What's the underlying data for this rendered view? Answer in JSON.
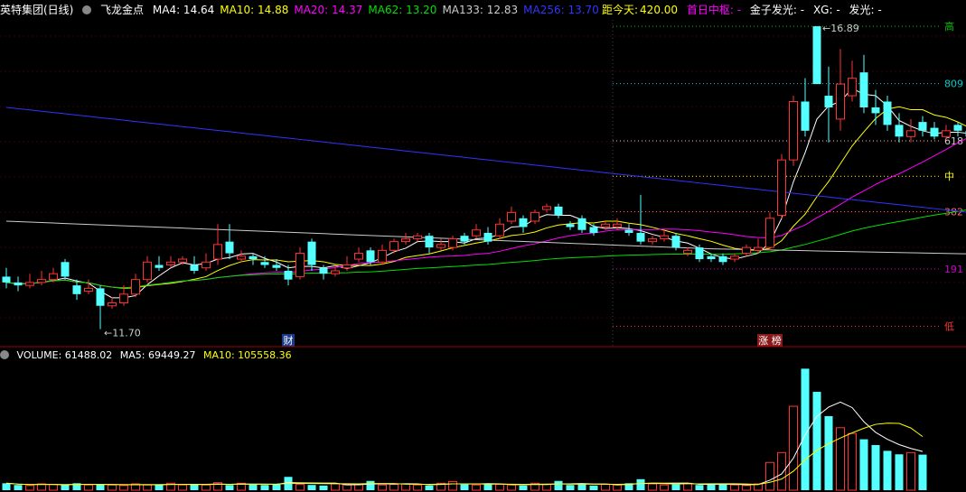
{
  "header": {
    "stock_name": "英特集团(日线)",
    "indicator_name": "飞龙金点",
    "ma": [
      {
        "label": "MA4:",
        "value": "14.64",
        "color": "#ffffff"
      },
      {
        "label": "MA10:",
        "value": "14.88",
        "color": "#ffff00"
      },
      {
        "label": "MA20:",
        "value": "14.37",
        "color": "#ff00ff"
      },
      {
        "label": "MA62:",
        "value": "13.20",
        "color": "#00e000"
      },
      {
        "label": "MA133:",
        "value": "12.83",
        "color": "#cccccc"
      },
      {
        "label": "MA256:",
        "value": "13.70",
        "color": "#3333ff"
      }
    ],
    "right": {
      "days_label": "距今天:",
      "days_value": "420.00",
      "first_day": "首日中枢: -",
      "signal1": "金子发光: -",
      "xg": "XG: -",
      "signal2": "发光: -"
    }
  },
  "price_axis": {
    "high_label": "16.89",
    "low_label": "11.70",
    "fib": [
      {
        "label": "高",
        "color": "#00c000"
      },
      {
        "label": "809",
        "color": "#00cccc"
      },
      {
        "label": "618",
        "color": "#cccccc"
      },
      {
        "label": "中",
        "color": "#ffff00"
      },
      {
        "label": "382",
        "color": "#ff6666"
      },
      {
        "label": "191",
        "color": "#cc00cc"
      },
      {
        "label": "低",
        "color": "#ff3333"
      }
    ],
    "markers": [
      {
        "label": "财"
      },
      {
        "label": "涨 榜"
      }
    ]
  },
  "volume_header": {
    "volume": "VOLUME: 61488.02",
    "ma5": "MA5: 69449.27",
    "ma10": "MA10: 105558.36"
  },
  "chart_data": {
    "type": "candlestick",
    "price_range": [
      11.4,
      17.0
    ],
    "candles": [
      [
        12.6,
        12.5,
        12.75,
        12.4
      ],
      [
        12.5,
        12.45,
        12.6,
        12.35
      ],
      [
        12.45,
        12.5,
        12.65,
        12.4
      ],
      [
        12.5,
        12.55,
        12.7,
        12.45
      ],
      [
        12.55,
        12.65,
        12.75,
        12.5
      ],
      [
        12.85,
        12.6,
        12.9,
        12.55
      ],
      [
        12.45,
        12.3,
        12.55,
        12.2
      ],
      [
        12.35,
        12.4,
        12.55,
        12.3
      ],
      [
        12.4,
        12.1,
        12.45,
        11.7
      ],
      [
        12.1,
        12.15,
        12.25,
        12.05
      ],
      [
        12.15,
        12.3,
        12.45,
        12.1
      ],
      [
        12.3,
        12.55,
        12.65,
        12.25
      ],
      [
        12.55,
        12.85,
        12.95,
        12.5
      ],
      [
        12.8,
        12.75,
        12.95,
        12.7
      ],
      [
        12.8,
        12.85,
        12.95,
        12.75
      ],
      [
        12.85,
        12.9,
        12.95,
        12.8
      ],
      [
        12.8,
        12.7,
        12.95,
        12.65
      ],
      [
        12.75,
        12.85,
        13.0,
        12.7
      ],
      [
        12.9,
        13.15,
        13.5,
        12.8
      ],
      [
        13.2,
        13.0,
        13.5,
        12.9
      ],
      [
        12.9,
        12.95,
        13.05,
        12.85
      ],
      [
        12.95,
        12.9,
        13.0,
        12.8
      ],
      [
        12.85,
        12.8,
        12.95,
        12.75
      ],
      [
        12.8,
        12.75,
        12.9,
        12.7
      ],
      [
        12.7,
        12.55,
        12.8,
        12.45
      ],
      [
        12.6,
        13.0,
        13.1,
        12.55
      ],
      [
        13.2,
        12.8,
        13.25,
        12.7
      ],
      [
        12.75,
        12.65,
        12.8,
        12.55
      ],
      [
        12.65,
        12.7,
        12.8,
        12.6
      ],
      [
        12.75,
        12.8,
        12.95,
        12.7
      ],
      [
        12.9,
        13.0,
        13.1,
        12.85
      ],
      [
        13.05,
        12.85,
        13.1,
        12.8
      ],
      [
        12.85,
        13.05,
        13.15,
        12.8
      ],
      [
        13.05,
        13.2,
        13.25,
        13.0
      ],
      [
        13.2,
        13.25,
        13.35,
        13.15
      ],
      [
        13.25,
        13.3,
        13.35,
        13.2
      ],
      [
        13.3,
        13.1,
        13.35,
        13.0
      ],
      [
        13.1,
        13.15,
        13.25,
        13.05
      ],
      [
        13.1,
        13.25,
        13.3,
        13.05
      ],
      [
        13.3,
        13.2,
        13.35,
        13.15
      ],
      [
        13.3,
        13.4,
        13.5,
        13.25
      ],
      [
        13.35,
        13.2,
        13.45,
        13.15
      ],
      [
        13.3,
        13.5,
        13.6,
        13.25
      ],
      [
        13.55,
        13.7,
        13.8,
        13.5
      ],
      [
        13.6,
        13.45,
        13.65,
        13.35
      ],
      [
        13.55,
        13.7,
        13.75,
        13.5
      ],
      [
        13.75,
        13.8,
        13.85,
        13.7
      ],
      [
        13.8,
        13.65,
        13.85,
        13.6
      ],
      [
        13.5,
        13.45,
        13.55,
        13.4
      ],
      [
        13.6,
        13.4,
        13.65,
        13.35
      ],
      [
        13.45,
        13.35,
        13.5,
        13.3
      ],
      [
        13.45,
        13.5,
        13.55,
        13.4
      ],
      [
        13.45,
        13.5,
        13.6,
        13.4
      ],
      [
        13.4,
        13.35,
        13.5,
        13.3
      ],
      [
        13.35,
        13.2,
        14.0,
        13.15
      ],
      [
        13.2,
        13.25,
        13.3,
        13.15
      ],
      [
        13.25,
        13.3,
        13.4,
        13.2
      ],
      [
        13.3,
        13.1,
        13.35,
        13.05
      ],
      [
        13.0,
        13.05,
        13.1,
        12.95
      ],
      [
        13.1,
        12.9,
        13.15,
        12.85
      ],
      [
        12.95,
        12.9,
        13.0,
        12.85
      ],
      [
        12.95,
        12.85,
        13.0,
        12.8
      ],
      [
        12.9,
        12.95,
        13.0,
        12.85
      ],
      [
        13.0,
        13.1,
        13.15,
        12.95
      ],
      [
        13.05,
        13.1,
        13.25,
        13.0
      ],
      [
        13.1,
        13.6,
        13.7,
        13.05
      ],
      [
        13.65,
        14.6,
        14.7,
        13.6
      ],
      [
        14.6,
        15.6,
        15.7,
        14.5
      ],
      [
        15.6,
        15.1,
        16.0,
        15.0
      ],
      [
        16.89,
        15.9,
        16.89,
        15.9
      ],
      [
        15.7,
        15.5,
        16.2,
        14.9
      ],
      [
        15.3,
        15.9,
        16.5,
        15.1
      ],
      [
        15.7,
        16.0,
        16.3,
        15.6
      ],
      [
        16.1,
        15.5,
        16.4,
        15.4
      ],
      [
        15.5,
        15.4,
        15.8,
        15.2
      ],
      [
        15.6,
        15.2,
        15.7,
        15.1
      ],
      [
        15.2,
        15.0,
        15.4,
        14.9
      ],
      [
        15.0,
        15.1,
        15.3,
        14.9
      ],
      [
        15.25,
        15.1,
        15.35,
        15.0
      ],
      [
        15.15,
        15.0,
        15.25,
        14.95
      ],
      [
        15.0,
        15.1,
        15.2,
        14.95
      ],
      [
        15.2,
        15.1,
        15.25,
        15.0
      ],
      [
        15.1,
        15.0,
        15.2,
        14.95
      ]
    ],
    "ma_lines": [
      {
        "name": "MA4",
        "color": "#ffffff"
      },
      {
        "name": "MA10",
        "color": "#ffff00"
      },
      {
        "name": "MA20",
        "color": "#ff00ff"
      },
      {
        "name": "MA62",
        "color": "#00e000"
      },
      {
        "name": "MA133",
        "color": "#cccccc"
      },
      {
        "name": "MA256",
        "color": "#3333ff"
      }
    ],
    "volume": [
      12000,
      9000,
      8000,
      11000,
      10000,
      9000,
      12000,
      9000,
      10000,
      9000,
      8000,
      11000,
      9000,
      10000,
      12000,
      9000,
      11000,
      9000,
      13000,
      9000,
      12000,
      10000,
      9000,
      11000,
      23000,
      10000,
      9000,
      8000,
      11000,
      9000,
      10000,
      16000,
      9000,
      10000,
      11000,
      9000,
      8000,
      12000,
      15000,
      10000,
      9000,
      11000,
      10000,
      9000,
      8000,
      12000,
      10000,
      16000,
      9000,
      11000,
      8000,
      10000,
      9000,
      12000,
      19000,
      11000,
      9000,
      10000,
      12000,
      9000,
      11000,
      10000,
      9000,
      8000,
      11000,
      48000,
      65000,
      145000,
      210000,
      170000,
      128000,
      108000,
      98000,
      88000,
      78000,
      68000,
      62000,
      65000,
      61488
    ]
  }
}
